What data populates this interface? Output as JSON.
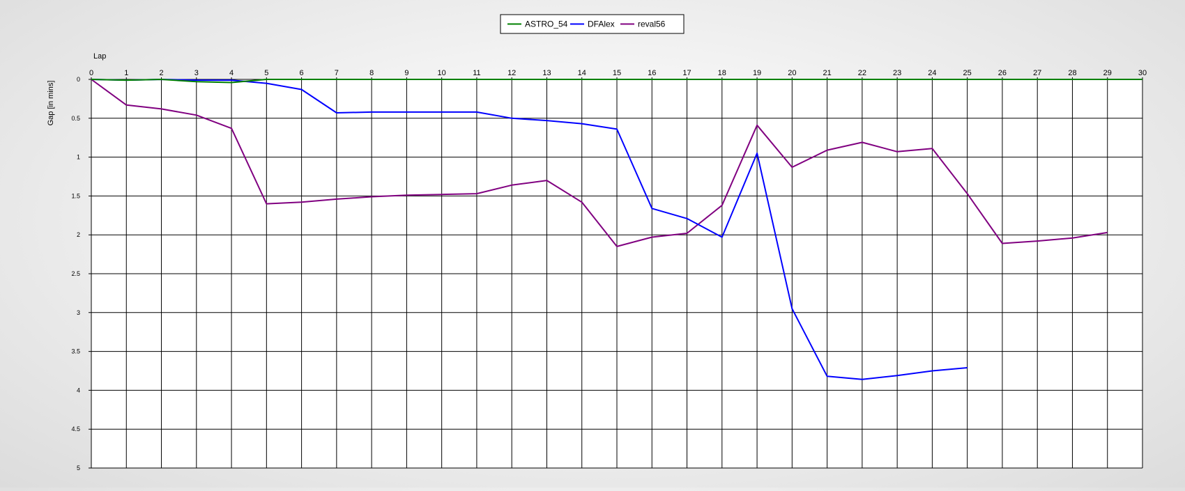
{
  "chart_data": {
    "type": "line",
    "xlabel": "Lap",
    "ylabel": "Gap [in mins]",
    "xlim": [
      0,
      30
    ],
    "ylim": [
      0,
      5
    ],
    "y_inverted": true,
    "x_ticks": [
      0,
      1,
      2,
      3,
      4,
      5,
      6,
      7,
      8,
      9,
      10,
      11,
      12,
      13,
      14,
      15,
      16,
      17,
      18,
      19,
      20,
      21,
      22,
      23,
      24,
      25,
      26,
      27,
      28,
      29,
      30
    ],
    "y_ticks": [
      {
        "value": 0,
        "label": "0"
      },
      {
        "value": 0.5,
        "label": "0.5"
      },
      {
        "value": 1,
        "label": "1"
      },
      {
        "value": 1.5,
        "label": "1.5"
      },
      {
        "value": 2,
        "label": "2"
      },
      {
        "value": 2.5,
        "label": "2.5"
      },
      {
        "value": 3,
        "label": "3"
      },
      {
        "value": 3.5,
        "label": "3.5"
      },
      {
        "value": 4,
        "label": "4"
      },
      {
        "value": 4.5,
        "label": "4.5"
      },
      {
        "value": 5,
        "label": "5"
      }
    ],
    "grid": true,
    "legend_position": "top-center",
    "series": [
      {
        "name": "ASTRO_54",
        "color": "#008000",
        "x": [
          0,
          1,
          2,
          3,
          4,
          4.5,
          5,
          6,
          7,
          8,
          9,
          10,
          11,
          12,
          13,
          14,
          15,
          16,
          17,
          18,
          19,
          20,
          21,
          22,
          23,
          24,
          25,
          26,
          27,
          28,
          29,
          30
        ],
        "y": [
          0,
          0.01,
          0.0,
          0.03,
          0.04,
          0.02,
          0,
          0,
          0,
          0,
          0,
          0,
          0,
          0,
          0,
          0,
          0,
          0,
          0,
          0,
          0,
          0,
          0,
          0,
          0,
          0,
          0,
          0,
          0,
          0,
          0,
          0
        ]
      },
      {
        "name": "DFAlex",
        "color": "#0000ff",
        "x": [
          0,
          1,
          2,
          3,
          4,
          5,
          6,
          7,
          8,
          9,
          10,
          11,
          12,
          13,
          14,
          15,
          16,
          17,
          18,
          19,
          20,
          21,
          22,
          23,
          24,
          25
        ],
        "y": [
          0,
          0.01,
          0.0,
          0.01,
          0.01,
          0.05,
          0.13,
          0.43,
          0.42,
          0.42,
          0.42,
          0.42,
          0.5,
          0.53,
          0.57,
          0.64,
          1.66,
          1.79,
          2.03,
          0.95,
          2.95,
          3.82,
          3.86,
          3.81,
          3.75,
          3.71
        ]
      },
      {
        "name": "reval56",
        "color": "#800080",
        "x": [
          0,
          1,
          2,
          3,
          4,
          5,
          6,
          7,
          8,
          9,
          10,
          11,
          12,
          13,
          14,
          15,
          16,
          17,
          18,
          19,
          20,
          21,
          22,
          23,
          24,
          25,
          26,
          27,
          28,
          29
        ],
        "y": [
          0,
          0.33,
          0.38,
          0.46,
          0.63,
          1.6,
          1.58,
          1.54,
          1.51,
          1.49,
          1.48,
          1.47,
          1.36,
          1.3,
          1.58,
          2.15,
          2.03,
          1.98,
          1.62,
          0.59,
          1.13,
          0.91,
          0.81,
          0.93,
          0.89,
          1.47,
          2.11,
          2.08,
          2.04,
          1.97
        ]
      }
    ]
  }
}
